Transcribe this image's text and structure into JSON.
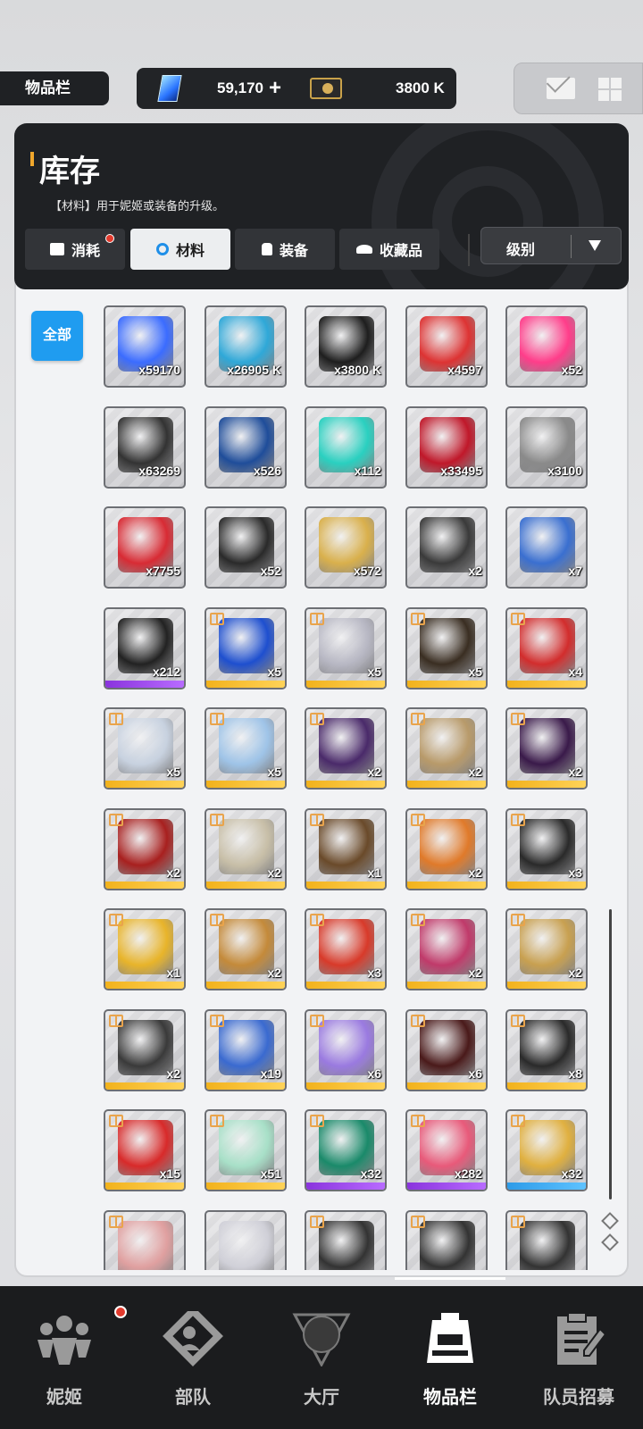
{
  "header": {
    "title": "物品栏",
    "gems": "59,170",
    "gems_plus": "+",
    "credits": "3800 K"
  },
  "panel": {
    "title": "库存",
    "description": "【材料】用于妮姬或装备的升级。"
  },
  "tabs": [
    {
      "label": "消耗",
      "has_dot": true
    },
    {
      "label": "材料",
      "active": true
    },
    {
      "label": "装备"
    },
    {
      "label": "收藏品"
    }
  ],
  "sort": {
    "label": "级别"
  },
  "filter": {
    "all_label": "全部"
  },
  "items": [
    {
      "count": "x59170",
      "color": "#3b6cff",
      "strip": "none"
    },
    {
      "count": "x26905 K",
      "color": "#2fa8d8",
      "strip": "none"
    },
    {
      "count": "x3800 K",
      "color": "#1e1e1e",
      "strip": "none"
    },
    {
      "count": "x4597",
      "color": "#d33",
      "strip": "none"
    },
    {
      "count": "x52",
      "color": "#ff3d8a",
      "strip": "none"
    },
    {
      "count": "x63269",
      "color": "#333",
      "strip": "none"
    },
    {
      "count": "x526",
      "color": "#1f4d9a",
      "strip": "none"
    },
    {
      "count": "x112",
      "color": "#2ad0c0",
      "strip": "none"
    },
    {
      "count": "x33495",
      "color": "#c0182a",
      "strip": "none"
    },
    {
      "count": "x3100",
      "color": "#8a8a8a",
      "strip": "none"
    },
    {
      "count": "x7755",
      "color": "#d82b34",
      "strip": "none"
    },
    {
      "count": "x52",
      "color": "#2a2a2a",
      "strip": "none"
    },
    {
      "count": "x572",
      "color": "#d9b04c",
      "strip": "none"
    },
    {
      "count": "x2",
      "color": "#3a3a3a",
      "strip": "none"
    },
    {
      "count": "x7",
      "color": "#3a6fd0",
      "strip": "none"
    },
    {
      "count": "x212",
      "color": "#222",
      "strip": "purple"
    },
    {
      "count": "x5",
      "color": "#1e4fcf",
      "strip": "gold",
      "gift": true
    },
    {
      "count": "x5",
      "color": "#b8b8c4",
      "strip": "gold",
      "gift": true
    },
    {
      "count": "x5",
      "color": "#3a2e22",
      "strip": "gold",
      "gift": true
    },
    {
      "count": "x4",
      "color": "#d22d2d",
      "strip": "gold",
      "gift": true
    },
    {
      "count": "x5",
      "color": "#c8d2e0",
      "strip": "gold",
      "gift": true
    },
    {
      "count": "x5",
      "color": "#9fc4e8",
      "strip": "gold",
      "gift": true
    },
    {
      "count": "x2",
      "color": "#4a2a6a",
      "strip": "gold",
      "gift": true
    },
    {
      "count": "x2",
      "color": "#b89a6a",
      "strip": "gold",
      "gift": true
    },
    {
      "count": "x2",
      "color": "#3a1a4a",
      "strip": "gold",
      "gift": true
    },
    {
      "count": "x2",
      "color": "#a8201f",
      "strip": "gold",
      "gift": true
    },
    {
      "count": "x2",
      "color": "#c8bfa8",
      "strip": "gold",
      "gift": true
    },
    {
      "count": "x1",
      "color": "#6a4a2a",
      "strip": "gold",
      "gift": true
    },
    {
      "count": "x2",
      "color": "#e07a2a",
      "strip": "gold",
      "gift": true
    },
    {
      "count": "x3",
      "color": "#2a2a2a",
      "strip": "gold",
      "gift": true
    },
    {
      "count": "x1",
      "color": "#e8b42a",
      "strip": "gold",
      "gift": true
    },
    {
      "count": "x2",
      "color": "#c48a3a",
      "strip": "gold",
      "gift": true
    },
    {
      "count": "x3",
      "color": "#d83a2a",
      "strip": "gold",
      "gift": true
    },
    {
      "count": "x2",
      "color": "#c03a6a",
      "strip": "gold",
      "gift": true
    },
    {
      "count": "x2",
      "color": "#c8a050",
      "strip": "gold",
      "gift": true
    },
    {
      "count": "x2",
      "color": "#3a3a3a",
      "strip": "gold",
      "gift": true
    },
    {
      "count": "x19",
      "color": "#3a6ad0",
      "strip": "gold",
      "gift": true
    },
    {
      "count": "x6",
      "color": "#9a7ae0",
      "strip": "gold",
      "gift": true
    },
    {
      "count": "x6",
      "color": "#4a1a1a",
      "strip": "gold",
      "gift": true
    },
    {
      "count": "x8",
      "color": "#2a2a2a",
      "strip": "gold",
      "gift": true
    },
    {
      "count": "x15",
      "color": "#d82a2a",
      "strip": "gold",
      "gift": true
    },
    {
      "count": "x51",
      "color": "#a8e0c8",
      "strip": "gold",
      "gift": true
    },
    {
      "count": "x32",
      "color": "#1a8a6a",
      "strip": "purple",
      "gift": true
    },
    {
      "count": "x282",
      "color": "#e85a7a",
      "strip": "purple",
      "gift": true
    },
    {
      "count": "x32",
      "color": "#e0b040",
      "strip": "blue",
      "gift": true
    },
    {
      "count": "",
      "color": "#e0a0a0",
      "strip": "none",
      "gift": true
    },
    {
      "count": "",
      "color": "#d0d0d8",
      "strip": "none"
    },
    {
      "count": "",
      "color": "#333",
      "strip": "none",
      "gift": true
    },
    {
      "count": "",
      "color": "#333",
      "strip": "none",
      "gift": true
    },
    {
      "count": "",
      "color": "#333",
      "strip": "none",
      "gift": true
    }
  ],
  "bottom_nav": [
    {
      "label": "妮姬",
      "has_dot": true
    },
    {
      "label": "部队"
    },
    {
      "label": "大厅"
    },
    {
      "label": "物品栏",
      "active": true
    },
    {
      "label": "队员招募"
    }
  ]
}
